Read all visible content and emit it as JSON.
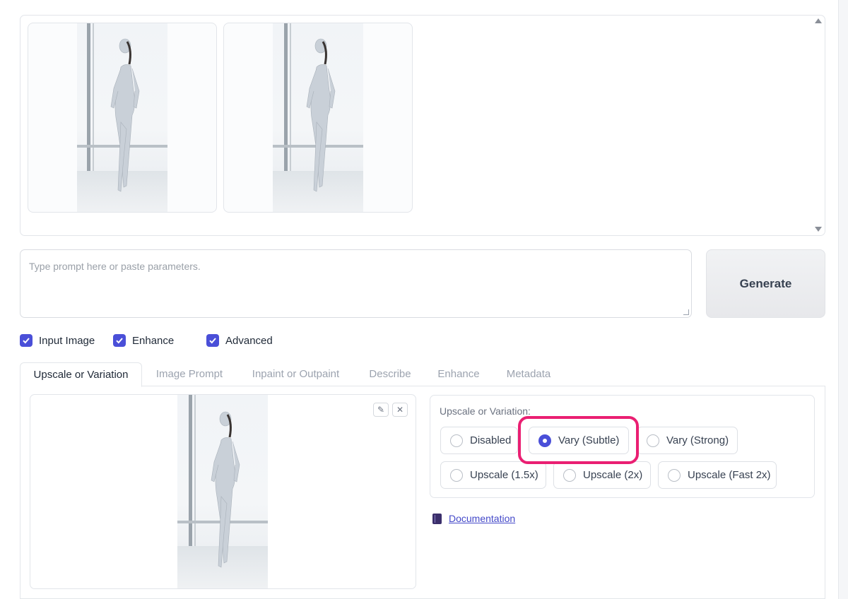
{
  "gallery": {
    "images": [
      {
        "alt": "woman in white bodysuit at window, variant 1"
      },
      {
        "alt": "woman in white bodysuit at window, variant 2"
      }
    ]
  },
  "prompt": {
    "placeholder": "Type prompt here or paste parameters.",
    "value": ""
  },
  "generate_label": "Generate",
  "options": {
    "input_image": {
      "label": "Input Image",
      "checked": true
    },
    "enhance": {
      "label": "Enhance",
      "checked": true
    },
    "advanced": {
      "label": "Advanced",
      "checked": true
    }
  },
  "tabs": [
    {
      "label": "Upscale or Variation",
      "active": true
    },
    {
      "label": "Image Prompt",
      "active": false
    },
    {
      "label": "Inpaint or Outpaint",
      "active": false
    },
    {
      "label": "Describe",
      "active": false
    },
    {
      "label": "Enhance",
      "active": false
    },
    {
      "label": "Metadata",
      "active": false
    }
  ],
  "upscale": {
    "title": "Upscale or Variation:",
    "options": [
      {
        "label": "Disabled",
        "selected": false
      },
      {
        "label": "Vary (Subtle)",
        "selected": true
      },
      {
        "label": "Vary (Strong)",
        "selected": false
      },
      {
        "label": "Upscale (1.5x)",
        "selected": false
      },
      {
        "label": "Upscale (2x)",
        "selected": false
      },
      {
        "label": "Upscale (Fast 2x)",
        "selected": false
      }
    ]
  },
  "documentation_label": "Documentation",
  "colors": {
    "accent": "#4a4fd8",
    "highlight": "#ea1f72",
    "link": "#4449c9"
  }
}
